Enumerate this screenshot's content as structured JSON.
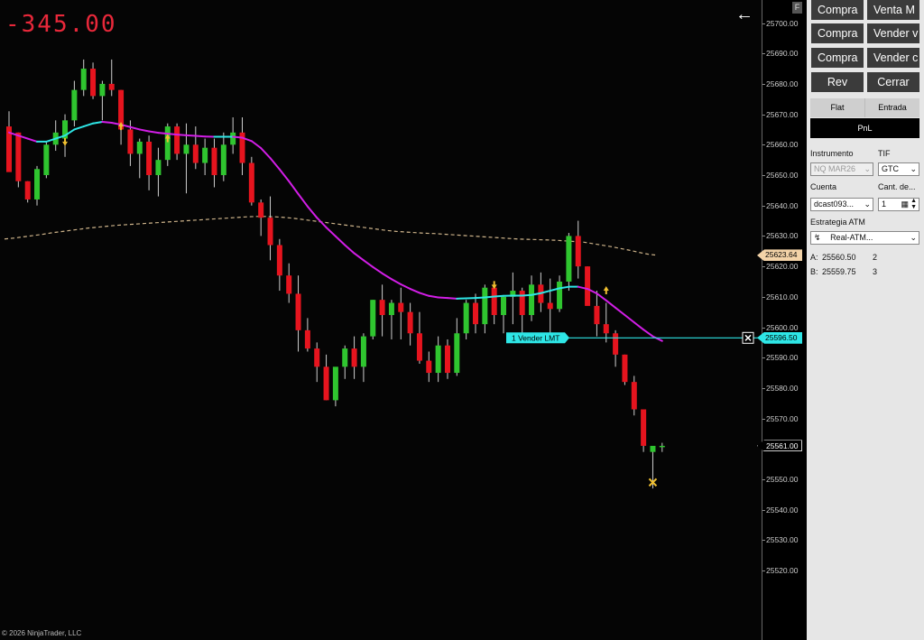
{
  "pnl_display": "-345.00",
  "copyright": "© 2026 NinjaTrader, LLC",
  "colors": {
    "up_candle": "#2fc52f",
    "down_candle": "#e6141e",
    "fast_ma_up": "#2ee6e6",
    "fast_ma_down": "#d21ee6",
    "slow_ma": "#cdb38a",
    "order_line": "#2ee6e6",
    "pnl": "#e8283a",
    "marker_yellow": "#f0c030"
  },
  "price_axis": {
    "range": [
      25518,
      25705
    ],
    "ticks": [
      "25700.00",
      "25690.00",
      "25680.00",
      "25670.00",
      "25660.00",
      "25650.00",
      "25640.00",
      "25630.00",
      "25620.00",
      "25610.00",
      "25600.00",
      "25590.00",
      "25580.00",
      "25570.00",
      "25560.00",
      "25550.00",
      "25540.00",
      "25530.00",
      "25520.00"
    ],
    "markers": {
      "slow_ma_value": "25623.64",
      "order_price": "25596.50",
      "last_price": "25561.00"
    }
  },
  "chart_data": {
    "type": "candlestick",
    "y_range": [
      25518,
      25705
    ],
    "ohlc": [
      [
        25666,
        25671,
        25662,
        25651
      ],
      [
        25664,
        25664,
        25646,
        25648
      ],
      [
        25648,
        25648,
        25641,
        25642
      ],
      [
        25642,
        25653,
        25640,
        25652
      ],
      [
        25650,
        25661,
        25649,
        25660
      ],
      [
        25660,
        25668,
        25658,
        25664
      ],
      [
        25662,
        25670,
        25656,
        25668
      ],
      [
        25668,
        25681,
        25666,
        25678
      ],
      [
        25678,
        25688,
        25676,
        25685
      ],
      [
        25685,
        25687,
        25675,
        25676
      ],
      [
        25676,
        25681,
        25668,
        25680
      ],
      [
        25680,
        25688,
        25676,
        25678
      ],
      [
        25678,
        25678,
        25660,
        25665
      ],
      [
        25665,
        25668,
        25653,
        25657
      ],
      [
        25657,
        25662,
        25649,
        25661
      ],
      [
        25661,
        25663,
        25645,
        25650
      ],
      [
        25650,
        25659,
        25643,
        25655
      ],
      [
        25655,
        25667,
        25653,
        25666
      ],
      [
        25666,
        25667,
        25655,
        25657
      ],
      [
        25657,
        25667,
        25644,
        25660
      ],
      [
        25660,
        25666,
        25652,
        25654
      ],
      [
        25654,
        25662,
        25650,
        25659
      ],
      [
        25659,
        25662,
        25646,
        25650
      ],
      [
        25650,
        25664,
        25648,
        25660
      ],
      [
        25660,
        25669,
        25657,
        25664
      ],
      [
        25664,
        25669,
        25650,
        25654
      ],
      [
        25654,
        25656,
        25640,
        25641
      ],
      [
        25641,
        25642,
        25630,
        25636
      ],
      [
        25636,
        25643,
        25622,
        25627
      ],
      [
        25627,
        25629,
        25612,
        25617
      ],
      [
        25617,
        25621,
        25608,
        25611
      ],
      [
        25611,
        25617,
        25592,
        25599
      ],
      [
        25599,
        25603,
        25592,
        25593
      ],
      [
        25593,
        25595,
        25582,
        25587
      ],
      [
        25587,
        25591,
        25576,
        25576
      ],
      [
        25576,
        25585,
        25574,
        25587
      ],
      [
        25587,
        25594,
        25583,
        25593
      ],
      [
        25593,
        25597,
        25583,
        25587
      ],
      [
        25587,
        25598,
        25582,
        25597
      ],
      [
        25597,
        25609,
        25596,
        25609
      ],
      [
        25609,
        25614,
        25597,
        25604
      ],
      [
        25604,
        25609,
        25596,
        25608
      ],
      [
        25608,
        25613,
        25596,
        25605
      ],
      [
        25605,
        25608,
        25594,
        25598
      ],
      [
        25598,
        25605,
        25588,
        25589
      ],
      [
        25589,
        25592,
        25582,
        25585
      ],
      [
        25585,
        25597,
        25582,
        25594
      ],
      [
        25594,
        25596,
        25583,
        25585
      ],
      [
        25585,
        25603,
        25584,
        25598
      ],
      [
        25598,
        25609,
        25596,
        25608
      ],
      [
        25608,
        25611,
        25598,
        25601
      ],
      [
        25601,
        25614,
        25598,
        25613
      ],
      [
        25613,
        25614,
        25601,
        25604
      ],
      [
        25604,
        25609,
        25598,
        25610
      ],
      [
        25610,
        25618,
        25601,
        25612
      ],
      [
        25612,
        25613,
        25598,
        25604
      ],
      [
        25604,
        25617,
        25602,
        25614
      ],
      [
        25614,
        25618,
        25605,
        25608
      ],
      [
        25608,
        25616,
        25598,
        25606
      ],
      [
        25606,
        25617,
        25605,
        25615
      ],
      [
        25615,
        25631,
        25612,
        25630
      ],
      [
        25630,
        25635,
        25616,
        25620
      ],
      [
        25620,
        25620,
        25608,
        25607
      ],
      [
        25607,
        25612,
        25597,
        25601
      ],
      [
        25601,
        25608,
        25595,
        25598
      ],
      [
        25598,
        25599,
        25587,
        25591
      ],
      [
        25591,
        25591,
        25581,
        25582
      ],
      [
        25582,
        25584,
        25571,
        25573
      ],
      [
        25573,
        25573,
        25559,
        25561
      ],
      [
        25559,
        25560,
        25547,
        25561
      ],
      [
        25561,
        25562,
        25559,
        25561
      ]
    ],
    "fast_ma": [
      25664,
      25663,
      25662,
      25661,
      25661,
      25662,
      25663,
      25665,
      25666,
      25667,
      25667.5,
      25667.2,
      25666.6,
      25665.8,
      25665,
      25664.4,
      25663.9,
      25663.6,
      25663.3,
      25663.1,
      25662.9,
      25662.7,
      25662.6,
      25662.6,
      25662.6,
      25662.3,
      25661.2,
      25658.9,
      25655.6,
      25651.9,
      25648,
      25643.8,
      25639.7,
      25636,
      25632.8,
      25629.9,
      25627,
      25624.3,
      25622,
      25619.8,
      25617.7,
      25615.8,
      25614.1,
      25612.6,
      25611.3,
      25610.3,
      25609.8,
      25609.6,
      25609.4,
      25609.5,
      25609.6,
      25609.8,
      25610.1,
      25610.3,
      25610.4,
      25610.4,
      25610.6,
      25611.2,
      25612,
      25612.8,
      25613.3,
      25613.3,
      25612.6,
      25611.1,
      25608.8,
      25606.4,
      25604,
      25601.6,
      25599.2,
      25597,
      25595.5
    ],
    "slow_ma_start_index": 0,
    "slow_ma": [
      25629,
      25629.3,
      25629.7,
      25630.1,
      25630.5,
      25631,
      25631.4,
      25631.8,
      25632.2,
      25632.6,
      25632.9,
      25633.2,
      25633.5,
      25633.7,
      25633.9,
      25634.1,
      25634.3,
      25634.5,
      25634.7,
      25634.9,
      25635.1,
      25635.3,
      25635.5,
      25635.7,
      25635.9,
      25636.1,
      25636.3,
      25636.4,
      25636.4,
      25636.3,
      25636.1,
      25635.8,
      25635.4,
      25635,
      25634.6,
      25634.2,
      25633.8,
      25633.4,
      25633,
      25632.6,
      25632.2,
      25631.8,
      25631.5,
      25631.3,
      25631.1,
      25630.9,
      25630.8,
      25630.6,
      25630.4,
      25630.2,
      25630,
      25629.8,
      25629.6,
      25629.4,
      25629.2,
      25629,
      25628.9,
      25628.8,
      25628.7,
      25628.6,
      25628.4,
      25628.2,
      25628,
      25627.5,
      25627,
      25626.5,
      25625.9,
      25625.3,
      25624.6,
      25624,
      25623.64
    ],
    "signal_markers": [
      {
        "index": 6,
        "price": 25661,
        "direction": "down"
      },
      {
        "index": 12,
        "price": 25666,
        "direction": "up"
      },
      {
        "index": 17,
        "price": 25662,
        "direction": "up"
      },
      {
        "index": 52,
        "price": 25614,
        "direction": "down"
      },
      {
        "index": 64,
        "price": 25612,
        "direction": "up"
      }
    ],
    "exit_marker": {
      "index": 69,
      "price": 25549
    },
    "order_line": {
      "price": 25596.5,
      "label": "1  Vender LMT"
    }
  },
  "order_panel": {
    "buttons": {
      "compra_1": "Compra",
      "venta_m": "Venta M",
      "compra_2": "Compra",
      "vender_v": "Vender v",
      "compra_3": "Compra",
      "vender_c": "Vender c",
      "rev": "Rev",
      "cerrar": "Cerrar"
    },
    "position_tabs": {
      "flat": "Flat",
      "entrada": "Entrada"
    },
    "pnl_label": "PnL",
    "instrumento_label": "Instrumento",
    "instrumento_value": "NQ MAR26",
    "tif_label": "TIF",
    "tif_value": "GTC",
    "cuenta_label": "Cuenta",
    "cuenta_value": "dcast093...",
    "cantidad_label": "Cant. de...",
    "cantidad_value": "1",
    "estrategia_label": "Estrategia ATM",
    "estrategia_value": "Real-ATM...",
    "ask_label": "A:",
    "ask_price": "25560.50",
    "ask_size": "2",
    "bid_label": "B:",
    "bid_price": "25559.75",
    "bid_size": "3"
  },
  "f_button": "F"
}
